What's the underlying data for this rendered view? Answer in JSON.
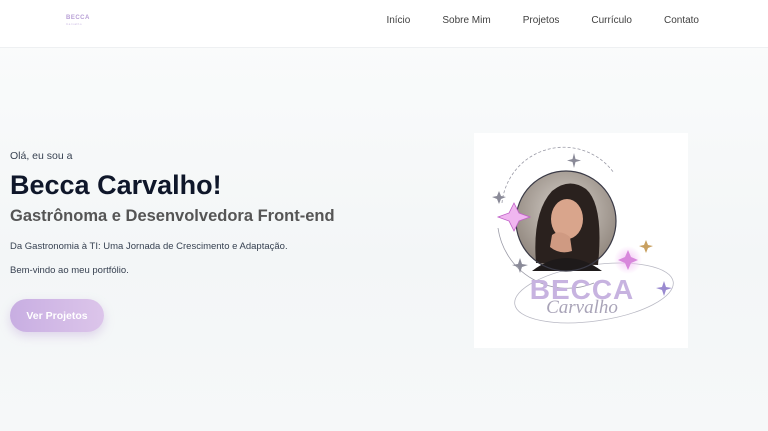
{
  "nav": {
    "logo_text": "BECCA",
    "logo_sub": "Carvalho",
    "items": [
      "Início",
      "Sobre Mim",
      "Projetos",
      "Currículo",
      "Contato"
    ]
  },
  "hero": {
    "greeting": "Olá, eu sou a",
    "name": "Becca Carvalho!",
    "subtitle": "Gastrônoma e Desenvolvedora Front-end",
    "description": "Da Gastronomia à TI: Uma Jornada de Crescimento e Adaptação.",
    "welcome": "Bem-vindo ao meu portfólio.",
    "button_label": "Ver Projetos"
  },
  "logo_art": {
    "title": "BECCA",
    "script": "Carvalho"
  },
  "colors": {
    "accent": "#c8aee2",
    "title": "#0f172a",
    "logo_purple": "#c7b3e0"
  }
}
